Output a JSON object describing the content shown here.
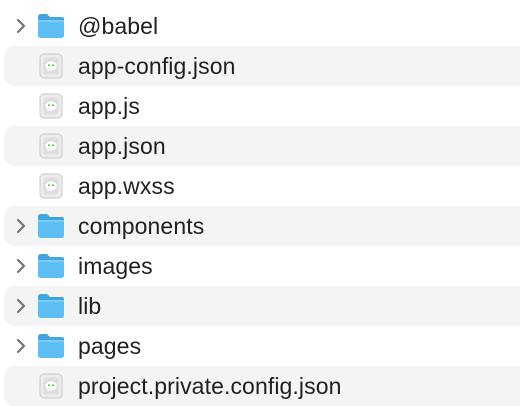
{
  "file_list": {
    "items": [
      {
        "label": "@babel",
        "kind": "folder",
        "expandable": true
      },
      {
        "label": "app-config.json",
        "kind": "file",
        "expandable": false
      },
      {
        "label": "app.js",
        "kind": "file",
        "expandable": false
      },
      {
        "label": "app.json",
        "kind": "file",
        "expandable": false
      },
      {
        "label": "app.wxss",
        "kind": "file",
        "expandable": false
      },
      {
        "label": "components",
        "kind": "folder",
        "expandable": true
      },
      {
        "label": "images",
        "kind": "folder",
        "expandable": true
      },
      {
        "label": "lib",
        "kind": "folder",
        "expandable": true
      },
      {
        "label": "pages",
        "kind": "folder",
        "expandable": true
      },
      {
        "label": "project.private.config.json",
        "kind": "file",
        "expandable": false
      }
    ]
  },
  "icons": {
    "folder": "folder-icon",
    "file": "wechat-file-icon",
    "disclosure": "chevron-right-icon"
  },
  "colors": {
    "folder_front": "#5cbef2",
    "folder_back": "#3fa6e3",
    "stripe": "#f4f4f4",
    "text": "#1f1f1f",
    "chevron": "#6e6e6e"
  }
}
